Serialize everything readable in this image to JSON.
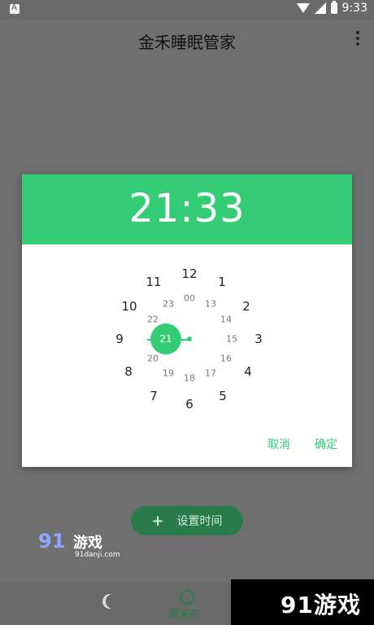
{
  "status_bar": {
    "time": "9:33",
    "left_icon": "android-icon"
  },
  "appbar": {
    "title": "金禾睡眠管家",
    "menu_icon": "more-vert-icon"
  },
  "time_picker": {
    "display_time": "21:33",
    "outer_hours": [
      "12",
      "1",
      "2",
      "3",
      "4",
      "5",
      "6",
      "7",
      "8",
      "9",
      "10",
      "11"
    ],
    "inner_hours": [
      "00",
      "13",
      "14",
      "15",
      "16",
      "17",
      "18",
      "19",
      "20",
      "21",
      "22",
      "23"
    ],
    "selected_hour": "21",
    "actions": {
      "cancel": "取消",
      "ok": "确定"
    }
  },
  "bottom": {
    "add_button_label": "设置时间",
    "nav_label_active": "醒来在"
  },
  "watermarks": {
    "left_logo": "91",
    "left_text": "游戏",
    "left_url": "91danji.com",
    "right_text": "91游戏"
  },
  "colors": {
    "accent": "#35cc76",
    "dark_green": "#2a7b4a"
  }
}
